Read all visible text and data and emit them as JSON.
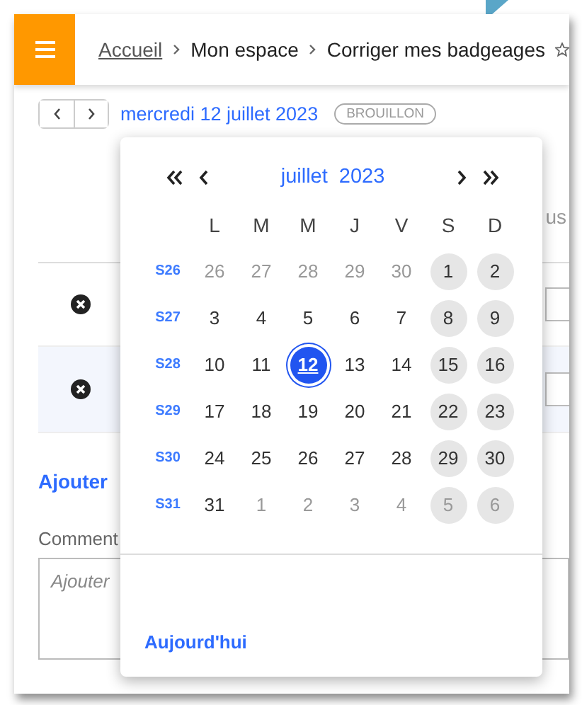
{
  "header": {
    "breadcrumb": [
      {
        "label": "Accueil",
        "link": true
      },
      {
        "label": "Mon espace",
        "link": false
      },
      {
        "label": "Corriger mes badgeages",
        "link": false
      }
    ]
  },
  "day_bar": {
    "date": "mercredi 12 juillet 2023",
    "status": "BROUILLON"
  },
  "background": {
    "column_label": "us",
    "rows": [
      {
        "highlighted": false
      },
      {
        "highlighted": true
      }
    ],
    "add_link": "Ajouter",
    "comment": {
      "label": "Comment",
      "placeholder": "Ajouter"
    }
  },
  "calendar": {
    "month": "juillet",
    "year": "2023",
    "weekdays": [
      "L",
      "M",
      "M",
      "J",
      "V",
      "S",
      "D"
    ],
    "weeks": [
      {
        "week": "S26",
        "days": [
          {
            "d": "26",
            "outside": true,
            "selected": false
          },
          {
            "d": "27",
            "outside": true,
            "selected": false
          },
          {
            "d": "28",
            "outside": true,
            "selected": false
          },
          {
            "d": "29",
            "outside": true,
            "selected": false
          },
          {
            "d": "30",
            "outside": true,
            "selected": false
          },
          {
            "d": "1",
            "outside": false,
            "selected": false
          },
          {
            "d": "2",
            "outside": false,
            "selected": false
          }
        ]
      },
      {
        "week": "S27",
        "days": [
          {
            "d": "3",
            "outside": false,
            "selected": false
          },
          {
            "d": "4",
            "outside": false,
            "selected": false
          },
          {
            "d": "5",
            "outside": false,
            "selected": false
          },
          {
            "d": "6",
            "outside": false,
            "selected": false
          },
          {
            "d": "7",
            "outside": false,
            "selected": false
          },
          {
            "d": "8",
            "outside": false,
            "selected": false
          },
          {
            "d": "9",
            "outside": false,
            "selected": false
          }
        ]
      },
      {
        "week": "S28",
        "days": [
          {
            "d": "10",
            "outside": false,
            "selected": false
          },
          {
            "d": "11",
            "outside": false,
            "selected": false
          },
          {
            "d": "12",
            "outside": false,
            "selected": true
          },
          {
            "d": "13",
            "outside": false,
            "selected": false
          },
          {
            "d": "14",
            "outside": false,
            "selected": false
          },
          {
            "d": "15",
            "outside": false,
            "selected": false
          },
          {
            "d": "16",
            "outside": false,
            "selected": false
          }
        ]
      },
      {
        "week": "S29",
        "days": [
          {
            "d": "17",
            "outside": false,
            "selected": false
          },
          {
            "d": "18",
            "outside": false,
            "selected": false
          },
          {
            "d": "19",
            "outside": false,
            "selected": false
          },
          {
            "d": "20",
            "outside": false,
            "selected": false
          },
          {
            "d": "21",
            "outside": false,
            "selected": false
          },
          {
            "d": "22",
            "outside": false,
            "selected": false
          },
          {
            "d": "23",
            "outside": false,
            "selected": false
          }
        ]
      },
      {
        "week": "S30",
        "days": [
          {
            "d": "24",
            "outside": false,
            "selected": false
          },
          {
            "d": "25",
            "outside": false,
            "selected": false
          },
          {
            "d": "26",
            "outside": false,
            "selected": false
          },
          {
            "d": "27",
            "outside": false,
            "selected": false
          },
          {
            "d": "28",
            "outside": false,
            "selected": false
          },
          {
            "d": "29",
            "outside": false,
            "selected": false
          },
          {
            "d": "30",
            "outside": false,
            "selected": false
          }
        ]
      },
      {
        "week": "S31",
        "days": [
          {
            "d": "31",
            "outside": false,
            "selected": false
          },
          {
            "d": "1",
            "outside": true,
            "selected": false
          },
          {
            "d": "2",
            "outside": true,
            "selected": false
          },
          {
            "d": "3",
            "outside": true,
            "selected": false
          },
          {
            "d": "4",
            "outside": true,
            "selected": false
          },
          {
            "d": "5",
            "outside": true,
            "selected": false
          },
          {
            "d": "6",
            "outside": true,
            "selected": false
          }
        ]
      }
    ],
    "today_button": "Aujourd'hui"
  }
}
